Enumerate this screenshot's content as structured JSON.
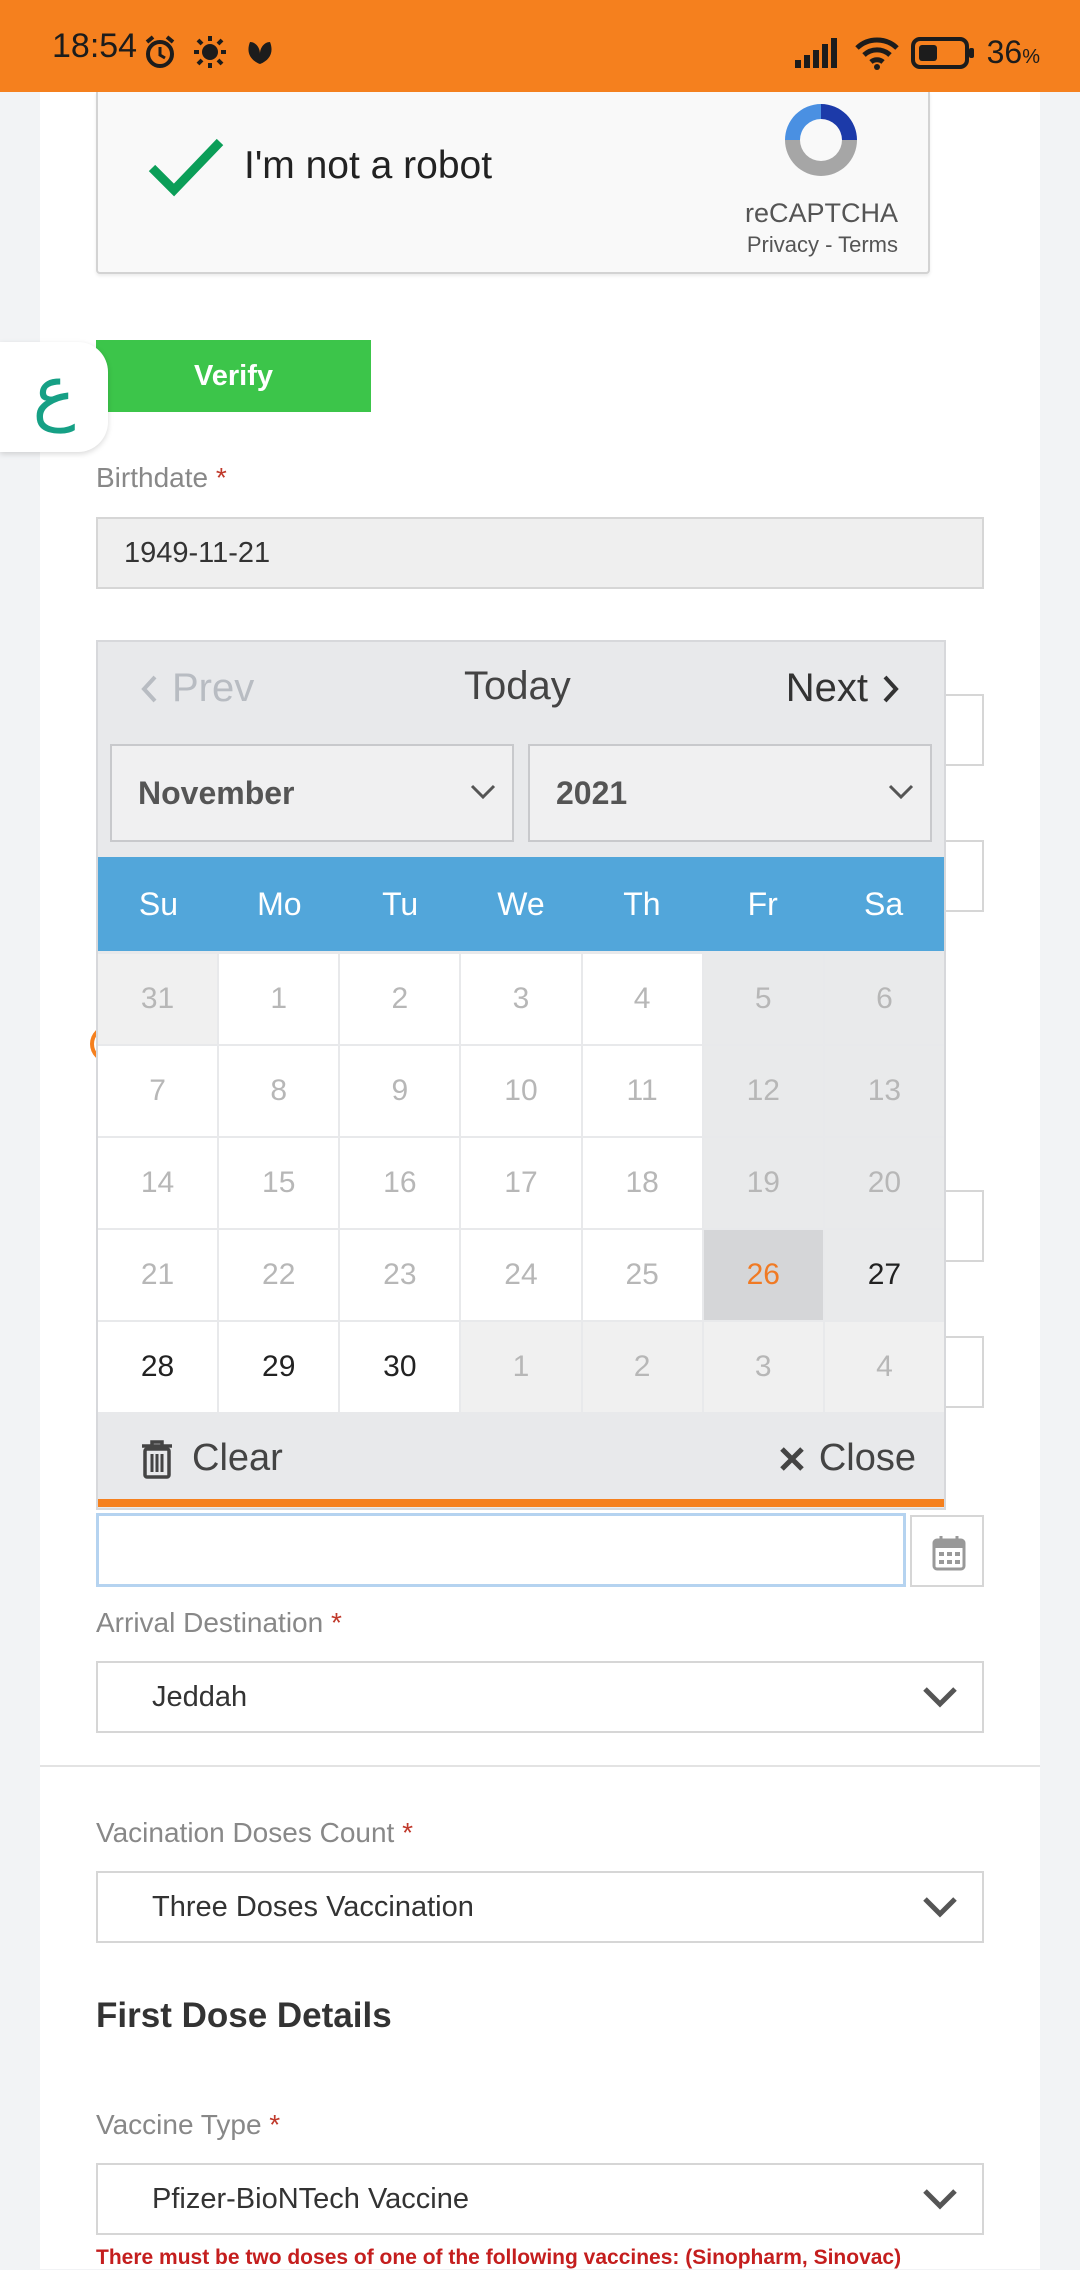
{
  "status_bar": {
    "time": "18:54",
    "battery_value": "36",
    "battery_unit": "%",
    "icons_left": [
      "alarm-icon",
      "brightness-icon",
      "weather-icon"
    ],
    "icons_right": [
      "signal-icon",
      "wifi-icon",
      "battery-icon"
    ]
  },
  "captcha": {
    "label": "I'm not a robot",
    "brand": "reCAPTCHA",
    "privacy": "Privacy",
    "separator": " - ",
    "terms": "Terms"
  },
  "verify_button": "Verify",
  "arabic_tab": "ع",
  "birthdate": {
    "label": "Birthdate",
    "required": "*",
    "value": "1949-11-21"
  },
  "datepicker": {
    "prev": "Prev",
    "today": "Today",
    "next": "Next",
    "month": "November",
    "year": "2021",
    "weekdays": [
      "Su",
      "Mo",
      "Tu",
      "We",
      "Th",
      "Fr",
      "Sa"
    ],
    "weeks": [
      [
        "31",
        "1",
        "2",
        "3",
        "4",
        "5",
        "6"
      ],
      [
        "7",
        "8",
        "9",
        "10",
        "11",
        "12",
        "13"
      ],
      [
        "14",
        "15",
        "16",
        "17",
        "18",
        "19",
        "20"
      ],
      [
        "21",
        "22",
        "23",
        "24",
        "25",
        "26",
        "27"
      ],
      [
        "28",
        "29",
        "30",
        "1",
        "2",
        "3",
        "4"
      ]
    ],
    "today_date": "26",
    "clear": "Clear",
    "close": "Close",
    "accent_color": "#f5801e",
    "header_color": "#52a6da"
  },
  "arrival": {
    "label": "Arrival Destination",
    "required": "*",
    "value": "Jeddah"
  },
  "doses": {
    "label": "Vacination Doses Count",
    "required": "*",
    "value": "Three Doses Vaccination"
  },
  "first_dose": {
    "title": "First Dose Details",
    "vaccine_label": "Vaccine Type",
    "required": "*",
    "vaccine_value": "Pfizer-BioNTech Vaccine",
    "warning": "There must be two doses of one of the following vaccines: (Sinopharm, Sinovac)"
  }
}
